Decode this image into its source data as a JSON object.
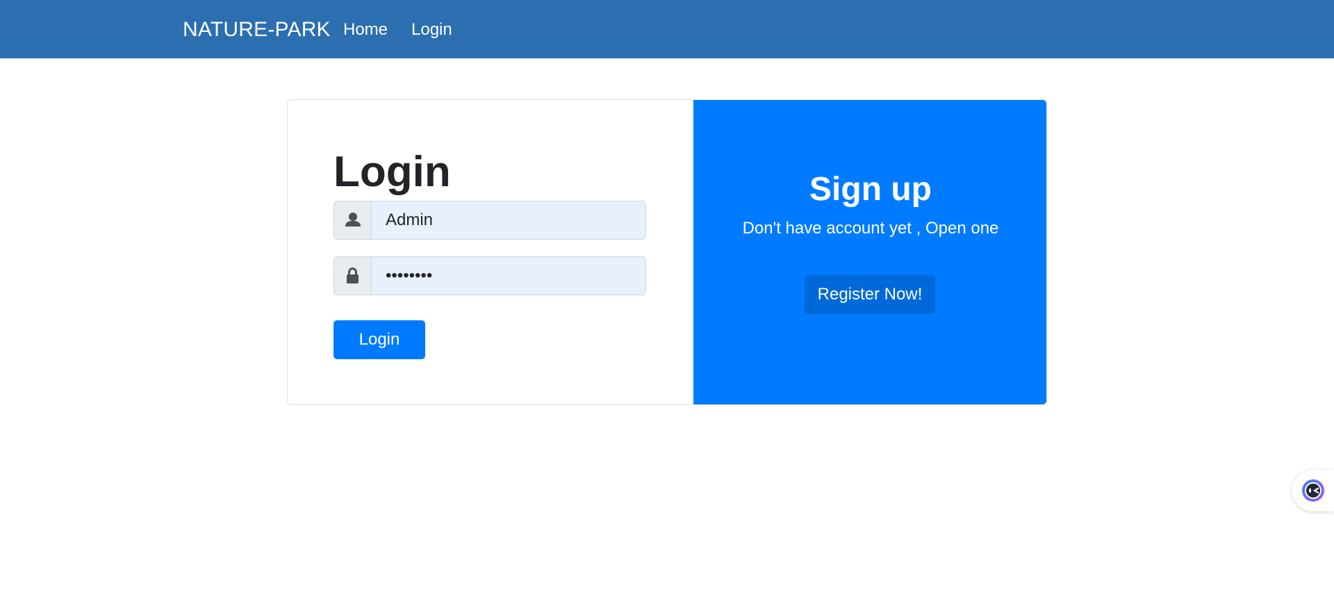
{
  "navbar": {
    "brand": "NATURE-PARK",
    "links": [
      {
        "label": "Home"
      },
      {
        "label": "Login"
      }
    ],
    "background": "#2c6fb0"
  },
  "login": {
    "title": "Login",
    "username": {
      "value": "Admin",
      "icon": "user-icon"
    },
    "password": {
      "value": "••••••••",
      "icon": "lock-icon"
    },
    "submit_label": "Login"
  },
  "signup": {
    "title": "Sign up",
    "subtitle": "Don't have account yet , Open one",
    "button_label": "Register Now!",
    "background": "#007bff"
  },
  "colors": {
    "primary": "#007bff",
    "primary_dark": "#0069d9",
    "input_autofill": "#e8f0fe"
  },
  "floating_widget": {
    "icon": "assistant-icon"
  }
}
